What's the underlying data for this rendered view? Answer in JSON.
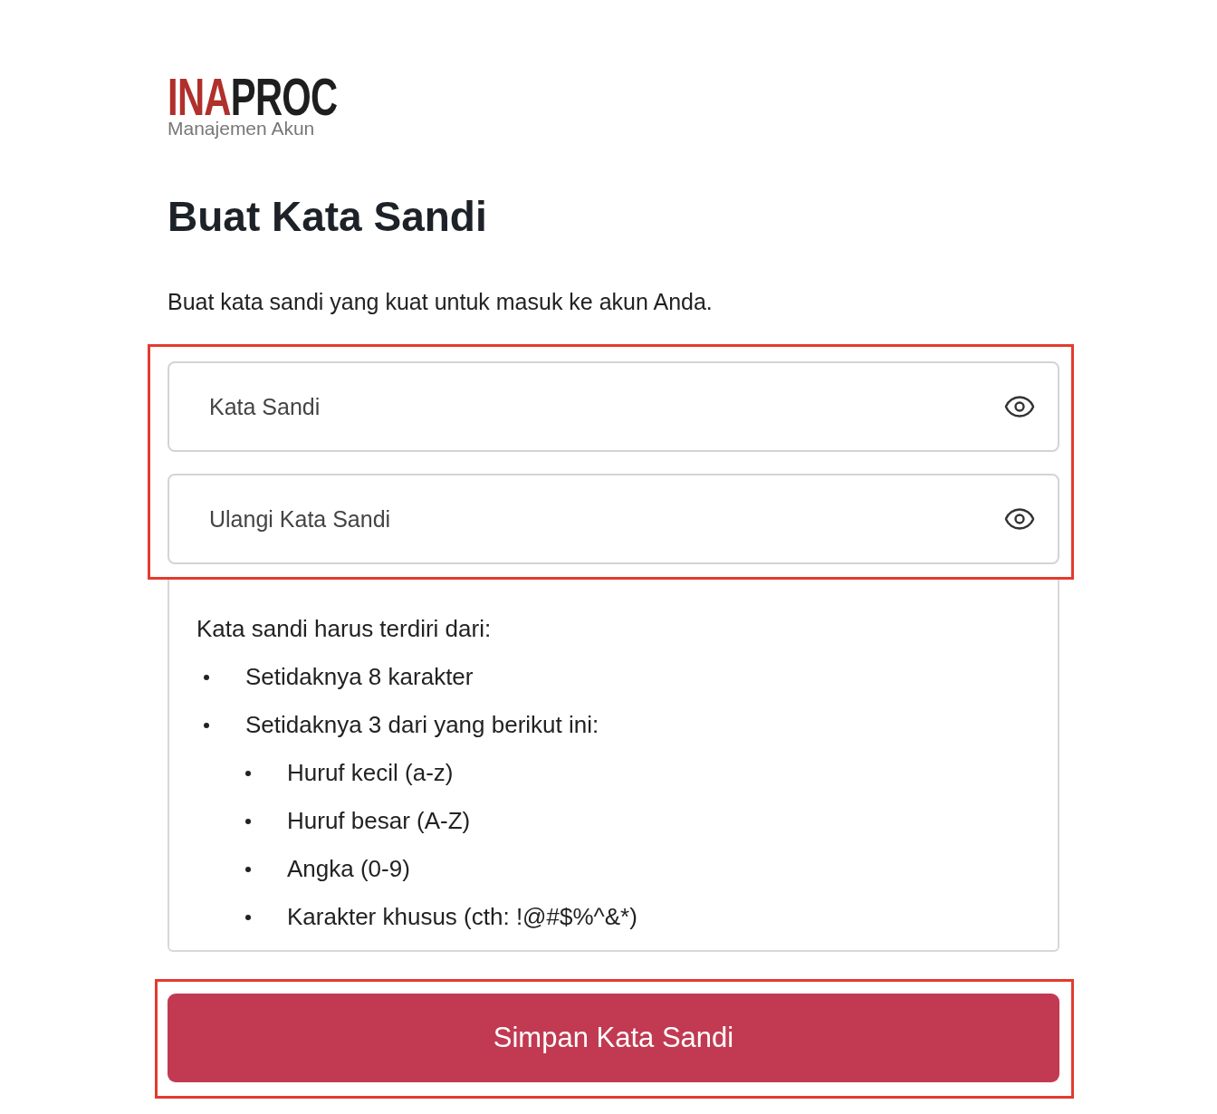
{
  "logo": {
    "brand_parts": [
      {
        "text": "INA",
        "color": "#b0302b"
      },
      {
        "text": "PROC",
        "color": "#1e1e1e"
      }
    ],
    "subtitle": "Manajemen Akun"
  },
  "title": "Buat Kata Sandi",
  "description": "Buat kata sandi yang kuat untuk masuk ke akun Anda.",
  "fields": [
    {
      "placeholder": "Kata Sandi"
    },
    {
      "placeholder": "Ulangi Kata Sandi"
    }
  ],
  "requirements": {
    "heading": "Kata sandi harus terdiri dari:",
    "items": [
      {
        "text": "Setidaknya 8 karakter"
      },
      {
        "text": "Setidaknya 3 dari yang berikut ini:",
        "children": [
          {
            "text": "Huruf kecil (a-z)"
          },
          {
            "text": "Huruf besar (A-Z)"
          },
          {
            "text": "Angka (0-9)"
          },
          {
            "text": "Karakter khusus (cth: !@#$%^&*)"
          }
        ]
      }
    ]
  },
  "submit_button": "Simpan Kata Sandi"
}
